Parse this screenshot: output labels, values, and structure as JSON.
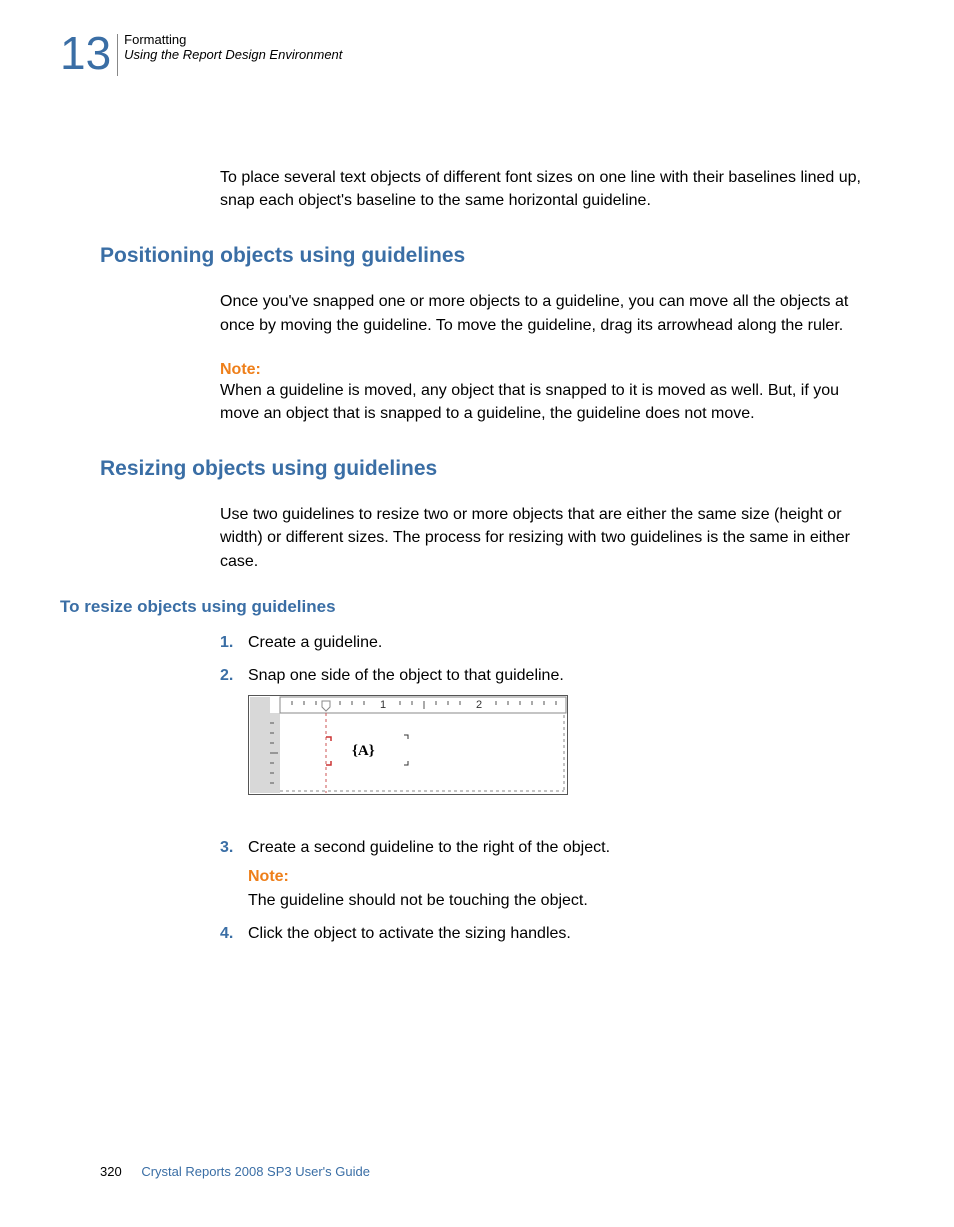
{
  "header": {
    "chapter_number": "13",
    "line1": "Formatting",
    "line2": "Using the Report Design Environment"
  },
  "intro_para": "To place several text objects of different font sizes on one line with their baselines lined up, snap each object's baseline to the same horizontal guideline.",
  "section1": {
    "heading": "Positioning objects using guidelines",
    "para": "Once you've snapped one or more objects to a guideline, you can move all the objects at once by moving the guideline. To move the guideline, drag its arrowhead along the ruler.",
    "note_label": "Note:",
    "note_text": "When a guideline is moved, any object that is snapped to it is moved as well. But, if you move an object that is snapped to a guideline, the guideline does not move."
  },
  "section2": {
    "heading": "Resizing objects using guidelines",
    "para": "Use two guidelines to resize two or more objects that are either the same size (height or width) or different sizes. The process for resizing with two guidelines is the same in either case.",
    "subheading": "To resize objects using guidelines",
    "steps": {
      "n1": "1.",
      "s1": "Create a guideline.",
      "n2": "2.",
      "s2": "Snap one side of the object to that guideline.",
      "n3": "3.",
      "s3": "Create a second guideline to the right of the object.",
      "note_label": "Note:",
      "note_text": "The guideline should not be touching the object.",
      "n4": "4.",
      "s4": "Click the object to activate the sizing handles."
    }
  },
  "figure": {
    "label_A": "{A}",
    "ruler_1": "1",
    "ruler_2": "2"
  },
  "footer": {
    "page": "320",
    "title": "Crystal Reports 2008 SP3 User's Guide"
  }
}
